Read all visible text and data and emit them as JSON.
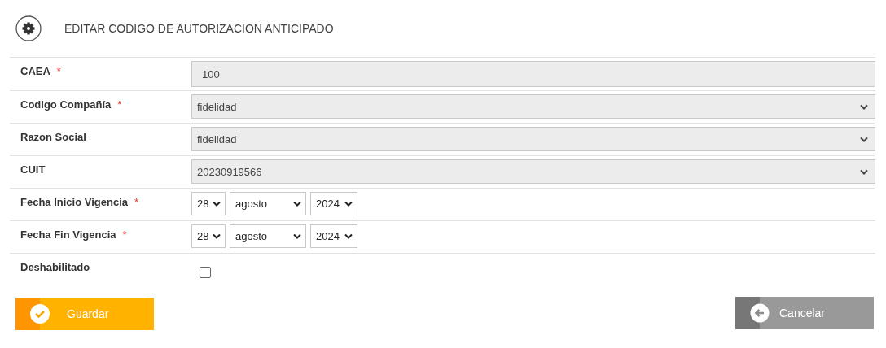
{
  "header": {
    "title": "EDITAR CODIGO DE AUTORIZACION ANTICIPADO"
  },
  "fields": [
    {
      "kind": "text",
      "label": "CAEA",
      "mark": "*",
      "value": "100"
    },
    {
      "kind": "select",
      "label": "Codigo Compañía",
      "mark": "*",
      "value": "fidelidad"
    },
    {
      "kind": "select",
      "label": "Razon Social",
      "value": "fidelidad"
    },
    {
      "kind": "select",
      "label": "CUIT",
      "value": "20230919566"
    },
    {
      "kind": "date",
      "label": "Fecha Inicio Vigencia",
      "mark": "*",
      "day": "28",
      "month": "agosto",
      "year": "2024"
    },
    {
      "kind": "date",
      "label": "Fecha Fin Vigencia",
      "mark": "*",
      "day": "28",
      "month": "agosto",
      "year": "2024"
    },
    {
      "kind": "checkbox",
      "label": "Deshabilitado",
      "checked": false
    }
  ],
  "buttons": [
    {
      "kind": "save",
      "label": "Guardar"
    },
    {
      "kind": "cancel",
      "label": "Cancelar"
    }
  ]
}
